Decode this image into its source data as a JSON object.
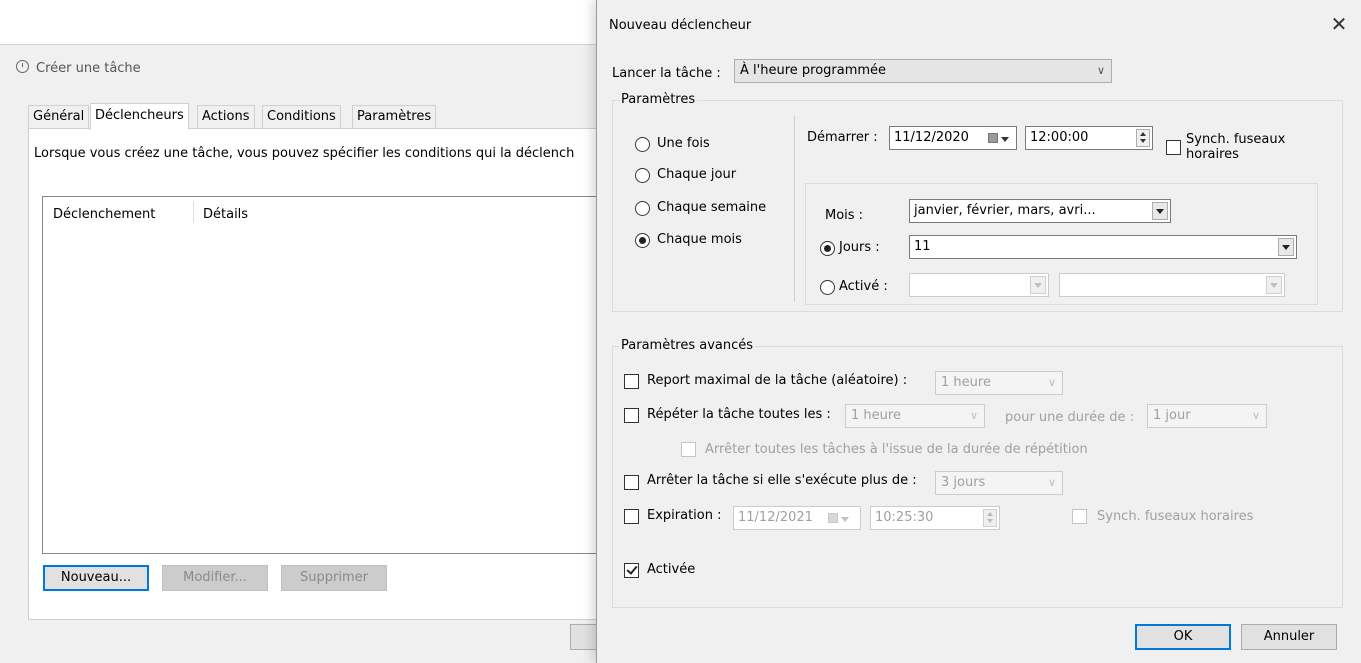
{
  "bg_window": {
    "title": "Créer une tâche",
    "tabs": [
      "Général",
      "Déclencheurs",
      "Actions",
      "Conditions",
      "Paramètres"
    ],
    "active_tab": "Déclencheurs",
    "description": "Lorsque vous créez une tâche, vous pouvez spécifier les conditions qui la déclench",
    "columns": [
      "Déclenchement",
      "Détails"
    ],
    "buttons": {
      "new": "Nouveau...",
      "edit": "Modifier...",
      "delete": "Supprimer"
    }
  },
  "dialog": {
    "title": "Nouveau déclencheur",
    "launch_label": "Lancer la tâche :",
    "launch_value": "À l'heure programmée",
    "settings_legend": "Paramètres",
    "frequency": [
      "Une fois",
      "Chaque jour",
      "Chaque semaine",
      "Chaque mois"
    ],
    "selected_frequency": "Chaque mois",
    "start_label": "Démarrer :",
    "start_date": "11/12/2020",
    "start_time": "12:00:00",
    "sync_tz": "Synch. fuseaux horaires",
    "months_label": "Mois :",
    "months_value": "janvier, février, mars, avri...",
    "days_label": "Jours :",
    "days_value": "11",
    "active_label": "Activé :",
    "advanced_legend": "Paramètres avancés",
    "delay_label": "Report maximal de la tâche (aléatoire) :",
    "delay_value": "1 heure",
    "repeat_label": "Répéter la tâche toutes les :",
    "repeat_value": "1 heure",
    "duration_label": "pour une durée de :",
    "duration_value": "1 jour",
    "stop_all_label": "Arrêter toutes les tâches à l'issue de la durée de répétition",
    "stop_if_label": "Arrêter la tâche si elle s'exécute plus de :",
    "stop_if_value": "3 jours",
    "expiration_label": "Expiration :",
    "expiration_date": "11/12/2021",
    "expiration_time": "10:25:30",
    "expiration_sync": "Synch. fuseaux horaires",
    "enabled_label": "Activée",
    "ok": "OK",
    "cancel": "Annuler"
  }
}
